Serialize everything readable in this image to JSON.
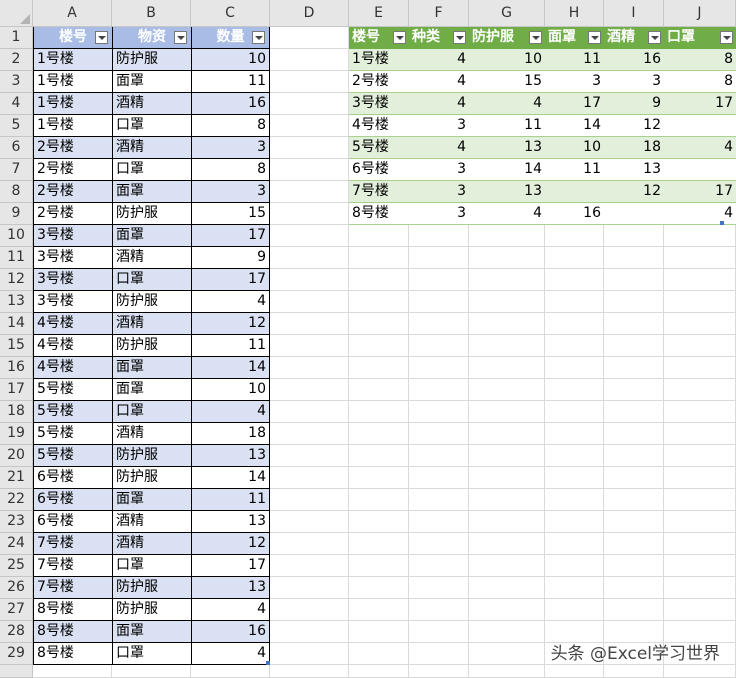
{
  "sheet": {
    "columns": [
      "A",
      "B",
      "C",
      "D",
      "E",
      "F",
      "G",
      "H",
      "I",
      "J"
    ],
    "rows": [
      "1",
      "2",
      "3",
      "4",
      "5",
      "6",
      "7",
      "8",
      "9",
      "10",
      "11",
      "12",
      "13",
      "14",
      "15",
      "16",
      "17",
      "18",
      "19",
      "20",
      "21",
      "22",
      "23",
      "24",
      "25",
      "26",
      "27",
      "28",
      "29"
    ]
  },
  "table1": {
    "headers": [
      "楼号",
      "物资",
      "数量"
    ],
    "rows": [
      [
        "1号楼",
        "防护服",
        "10"
      ],
      [
        "1号楼",
        "面罩",
        "11"
      ],
      [
        "1号楼",
        "酒精",
        "16"
      ],
      [
        "1号楼",
        "口罩",
        "8"
      ],
      [
        "2号楼",
        "酒精",
        "3"
      ],
      [
        "2号楼",
        "口罩",
        "8"
      ],
      [
        "2号楼",
        "面罩",
        "3"
      ],
      [
        "2号楼",
        "防护服",
        "15"
      ],
      [
        "3号楼",
        "面罩",
        "17"
      ],
      [
        "3号楼",
        "酒精",
        "9"
      ],
      [
        "3号楼",
        "口罩",
        "17"
      ],
      [
        "3号楼",
        "防护服",
        "4"
      ],
      [
        "4号楼",
        "酒精",
        "12"
      ],
      [
        "4号楼",
        "防护服",
        "11"
      ],
      [
        "4号楼",
        "面罩",
        "14"
      ],
      [
        "5号楼",
        "面罩",
        "10"
      ],
      [
        "5号楼",
        "口罩",
        "4"
      ],
      [
        "5号楼",
        "酒精",
        "18"
      ],
      [
        "5号楼",
        "防护服",
        "13"
      ],
      [
        "6号楼",
        "防护服",
        "14"
      ],
      [
        "6号楼",
        "面罩",
        "11"
      ],
      [
        "6号楼",
        "酒精",
        "13"
      ],
      [
        "7号楼",
        "酒精",
        "12"
      ],
      [
        "7号楼",
        "口罩",
        "17"
      ],
      [
        "7号楼",
        "防护服",
        "13"
      ],
      [
        "8号楼",
        "防护服",
        "4"
      ],
      [
        "8号楼",
        "面罩",
        "16"
      ],
      [
        "8号楼",
        "口罩",
        "4"
      ]
    ]
  },
  "table2": {
    "headers": [
      "楼号",
      "种类",
      "防护服",
      "面罩",
      "酒精",
      "口罩"
    ],
    "rows": [
      [
        "1号楼",
        "4",
        "10",
        "11",
        "16",
        "8"
      ],
      [
        "2号楼",
        "4",
        "15",
        "3",
        "3",
        "8"
      ],
      [
        "3号楼",
        "4",
        "4",
        "17",
        "9",
        "17"
      ],
      [
        "4号楼",
        "3",
        "11",
        "14",
        "12",
        ""
      ],
      [
        "5号楼",
        "4",
        "13",
        "10",
        "18",
        "4"
      ],
      [
        "6号楼",
        "3",
        "14",
        "11",
        "13",
        ""
      ],
      [
        "7号楼",
        "3",
        "13",
        "",
        "12",
        "17"
      ],
      [
        "8号楼",
        "3",
        "4",
        "16",
        "",
        "4"
      ]
    ]
  },
  "watermark": "头条 @Excel学习世界",
  "colors": {
    "table1_header": "#a9bce6",
    "table1_band": "#d9e1f2",
    "table2_header": "#70ad47",
    "table2_band": "#e2efda"
  }
}
